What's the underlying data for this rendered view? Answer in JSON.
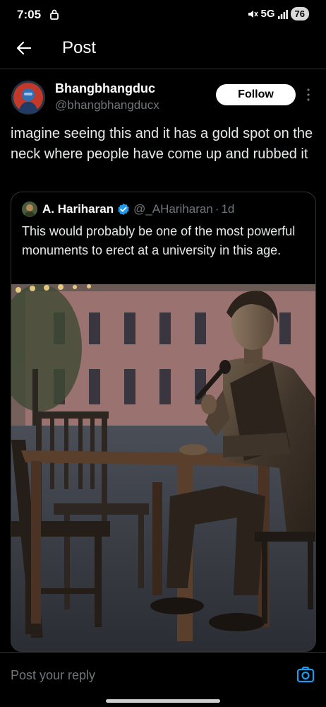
{
  "status_bar": {
    "time": "7:05",
    "network": "5G",
    "battery": "76"
  },
  "header": {
    "title": "Post"
  },
  "post": {
    "author_name": "Bhangbhangduc",
    "author_handle": "@bhangbhangducx",
    "follow_label": "Follow",
    "text": "imagine seeing this and it has a gold spot on the neck where people have come up and rubbed it",
    "quote": {
      "author_name": "A. Hariharan",
      "author_handle": "@_AHariharan",
      "separator": "·",
      "age": "1d",
      "text": "This would probably be one of the most powerful monuments to erect at a university in this age."
    }
  },
  "reply": {
    "placeholder": "Post your reply"
  },
  "colors": {
    "accent": "#1d9bf0",
    "background": "#000000",
    "muted": "#71767b",
    "border": "#2f3336"
  },
  "icons": [
    "lock-icon",
    "mute-icon",
    "signal-icon",
    "back-arrow-icon",
    "more-icon",
    "verified-icon",
    "camera-icon"
  ]
}
